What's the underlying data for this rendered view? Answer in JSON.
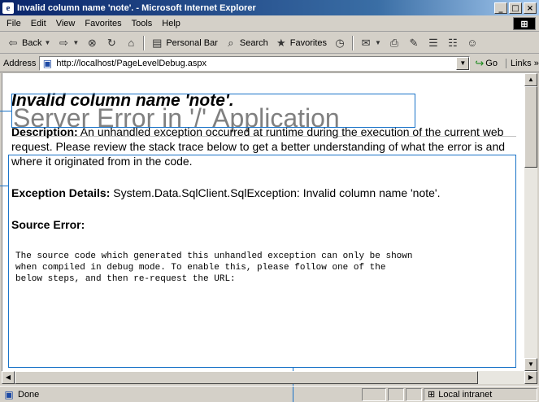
{
  "window": {
    "title": "Invalid column name 'note'. - Microsoft Internet Explorer",
    "minimize": "_",
    "maximize": " ",
    "close": "×"
  },
  "menu": [
    "File",
    "Edit",
    "View",
    "Favorites",
    "Tools",
    "Help"
  ],
  "toolbar": {
    "back_label": "Back",
    "personal_bar_label": "Personal Bar",
    "search_label": "Search",
    "favorites_label": "Favorites"
  },
  "address": {
    "label": "Address",
    "url": "http://localhost/PageLevelDebug.aspx",
    "go_label": "Go",
    "links_label": "Links »"
  },
  "page": {
    "title": "Server Error in '/' Application",
    "error_heading": "Invalid column name 'note'.",
    "description_label": "Description:",
    "description_text": " An unhandled exception occurred at runtime during the execution of the current web request. Please review the stack trace below to get a better understanding of what the error is and where it originated from in the code.",
    "exception_label": "Exception Details:",
    "exception_text": " System.Data.SqlClient.SqlException: Invalid column name 'note'.",
    "source_error_label": "Source Error:",
    "source_code_text": "The source code which generated this unhandled exception can only be shown\nwhen compiled in debug mode. To enable this, please follow one of the\nbelow steps, and then re-request the URL:"
  },
  "status": {
    "text": "Done",
    "zone": "Local intranet"
  },
  "colors": {
    "callout": "#1a73c8",
    "title_gray": "#808080",
    "titlebar": "#0a246a"
  }
}
